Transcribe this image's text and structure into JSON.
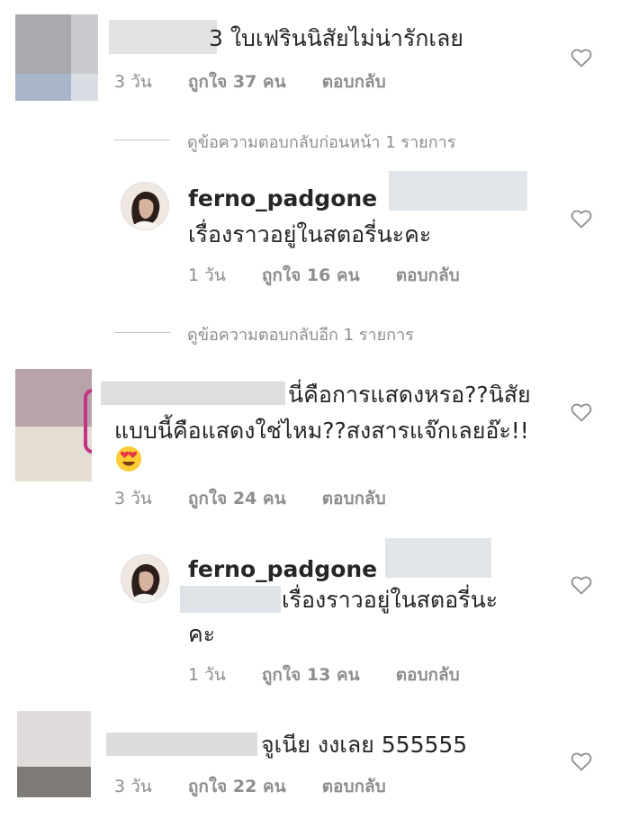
{
  "comments": [
    {
      "text": "3 ใบเฟรินนิสัยไม่น่ารักเลย",
      "time": "3 วัน",
      "likes": "ถูกใจ 37 คน",
      "reply": "ตอบกลับ"
    },
    {
      "username": "ferno_padgone",
      "text": "เรื่องราวอยู่ในสตอรี่นะคะ",
      "time": "1 วัน",
      "likes": "ถูกใจ 16 คน",
      "reply": "ตอบกลับ"
    },
    {
      "text_line1": "นี่คือการแสดงหรอ??นิสัย",
      "text_line2": "แบบนี้คือแสดงใช่ไหม??สงสารแจ๊กเลยอ๊ะ!!",
      "time": "3 วัน",
      "likes": "ถูกใจ 24 คน",
      "reply": "ตอบกลับ"
    },
    {
      "username": "ferno_padgone",
      "text_line1": "เรื่องราวอยู่ในสตอรี่นะ",
      "text_line2": "คะ",
      "time": "1 วัน",
      "likes": "ถูกใจ 13 คน",
      "reply": "ตอบกลับ"
    },
    {
      "text": "จูเนีย งงเลย 555555",
      "time": "3 วัน",
      "likes": "ถูกใจ 22 คน",
      "reply": "ตอบกลับ"
    }
  ],
  "separators": {
    "previous_replies": "ดูข้อความตอบกลับก่อนหน้า 1 รายการ",
    "more_replies": "ดูข้อความตอบกลับอีก 1 รายการ"
  },
  "icons": [
    "heart-outline-icon",
    "verified-badge-icon",
    "heart-eyes-emoji-icon"
  ],
  "colors": {
    "text": "#262626",
    "muted": "#8e8e8e",
    "verified": "#3897f0",
    "story_ring": "#c13584"
  }
}
